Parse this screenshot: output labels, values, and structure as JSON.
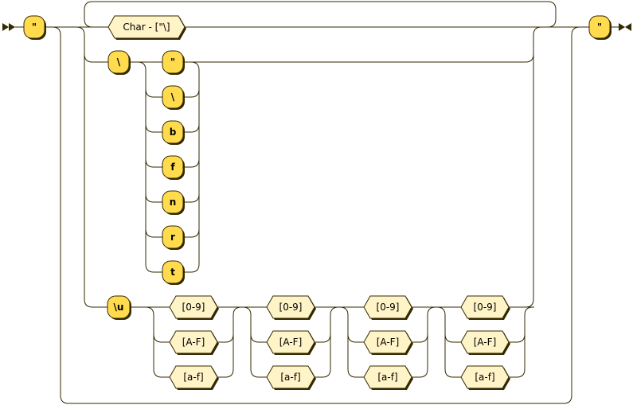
{
  "diagram": {
    "type": "railroad",
    "start_quote": "\"",
    "end_quote": "\"",
    "char_nonterminal": "Char - [\"\\]",
    "escape_backslash": "\\",
    "escape_chars": [
      "\"",
      "\\",
      "b",
      "f",
      "n",
      "r",
      "t"
    ],
    "unicode_prefix": "\\u",
    "hex_groups": [
      [
        "[0-9]",
        "[A-F]",
        "[a-f]"
      ],
      [
        "[0-9]",
        "[A-F]",
        "[a-f]"
      ],
      [
        "[0-9]",
        "[A-F]",
        "[a-f]"
      ],
      [
        "[0-9]",
        "[A-F]",
        "[a-f]"
      ]
    ]
  },
  "colors": {
    "line": "#332900",
    "terminal_fill": "#ffdb4d",
    "nonterminal_fill": "#fff4c7"
  }
}
